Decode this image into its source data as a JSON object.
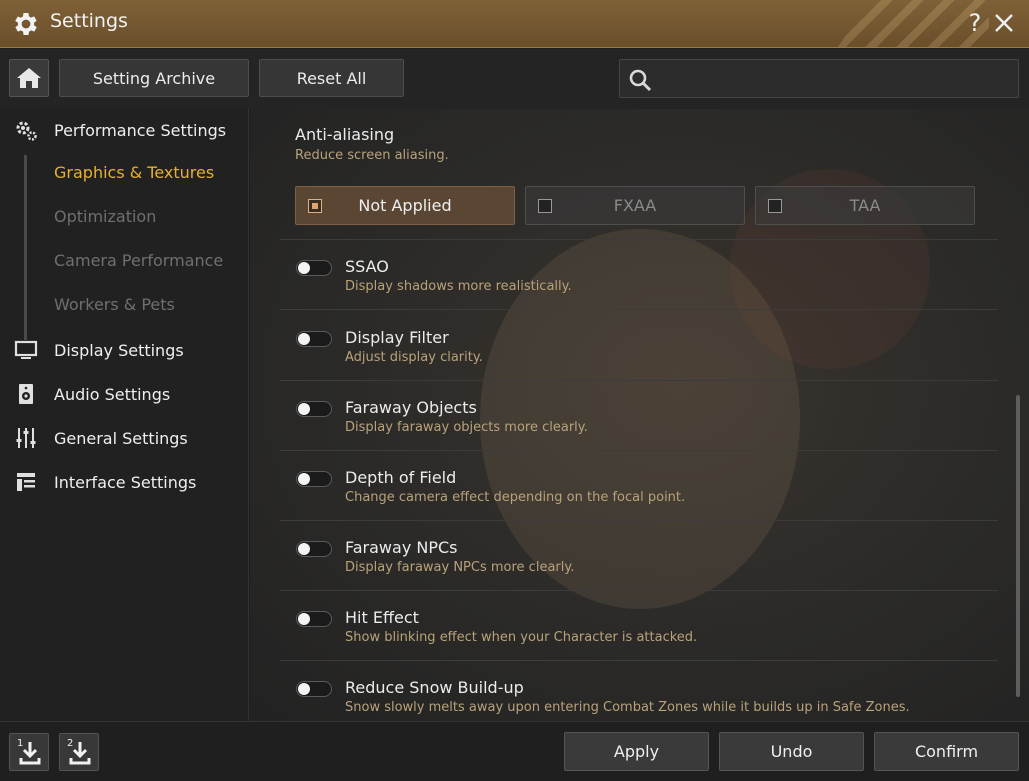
{
  "window": {
    "title": "Settings",
    "help_label": "?"
  },
  "toolbar": {
    "setting_archive_label": "Setting Archive",
    "reset_all_label": "Reset All",
    "search_placeholder": "",
    "search_value": ""
  },
  "sidebar": {
    "sections": [
      {
        "label": "Performance Settings",
        "icon": "gears-icon"
      },
      {
        "label": "Display Settings",
        "icon": "monitor-icon"
      },
      {
        "label": "Audio Settings",
        "icon": "speaker-icon"
      },
      {
        "label": "General Settings",
        "icon": "sliders-icon"
      },
      {
        "label": "Interface Settings",
        "icon": "layout-icon"
      }
    ],
    "sub_items": [
      {
        "label": "Graphics & Textures",
        "active": true
      },
      {
        "label": "Optimization",
        "active": false
      },
      {
        "label": "Camera Performance",
        "active": false
      },
      {
        "label": "Workers & Pets",
        "active": false
      }
    ]
  },
  "content": {
    "antialiasing": {
      "title": "Anti-aliasing",
      "description": "Reduce screen aliasing.",
      "options": [
        {
          "label": "Not Applied",
          "selected": true
        },
        {
          "label": "FXAA",
          "selected": false
        },
        {
          "label": "TAA",
          "selected": false
        }
      ]
    },
    "settings": [
      {
        "title": "SSAO",
        "description": "Display shadows more realistically.",
        "enabled": false
      },
      {
        "title": "Display Filter",
        "description": "Adjust display clarity.",
        "enabled": false
      },
      {
        "title": "Faraway Objects",
        "description": "Display faraway objects more clearly.",
        "enabled": false
      },
      {
        "title": "Depth of Field",
        "description": "Change camera effect depending on the focal point.",
        "enabled": false
      },
      {
        "title": "Faraway NPCs",
        "description": "Display faraway NPCs more clearly.",
        "enabled": false
      },
      {
        "title": "Hit Effect",
        "description": "Show blinking effect when your Character is attacked.",
        "enabled": false
      },
      {
        "title": "Reduce Snow Build-up",
        "description": "Snow slowly melts away upon entering Combat Zones while it builds up in Safe Zones.",
        "enabled": false
      }
    ]
  },
  "footer": {
    "save_slot_1_label": "1",
    "save_slot_2_label": "2",
    "apply_label": "Apply",
    "undo_label": "Undo",
    "confirm_label": "Confirm"
  },
  "colors": {
    "titlebar": "#7f6137",
    "accent_active": "#e6b033",
    "description_text": "#b8a27a",
    "selected_option": "#5b4634"
  }
}
